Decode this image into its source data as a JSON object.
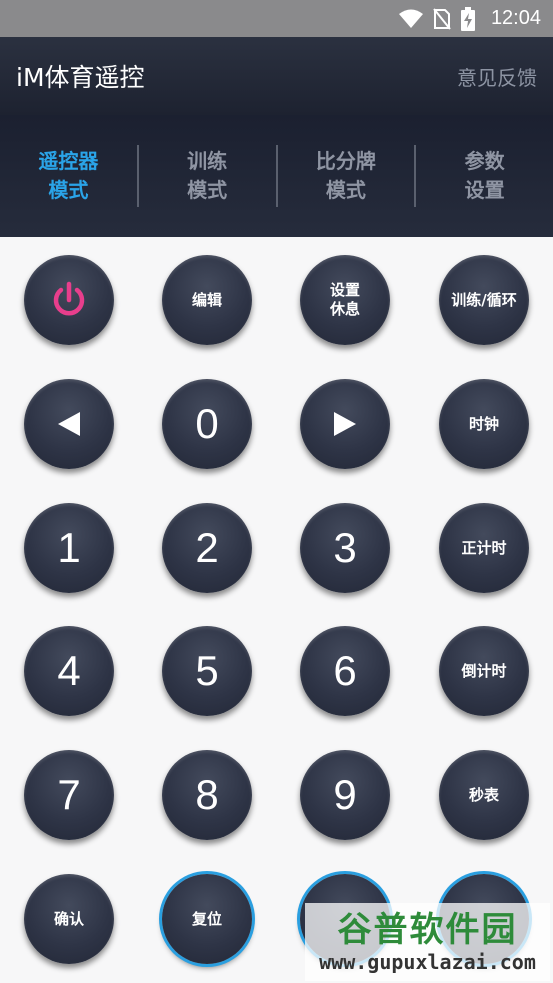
{
  "status_bar": {
    "time": "12:04"
  },
  "app_bar": {
    "title": "iM体育遥控",
    "feedback": "意见反馈"
  },
  "tabs": [
    {
      "line1": "遥控器",
      "line2": "模式",
      "active": true
    },
    {
      "line1": "训练",
      "line2": "模式",
      "active": false
    },
    {
      "line1": "比分牌",
      "line2": "模式",
      "active": false
    },
    {
      "line1": "参数",
      "line2": "设置",
      "active": false
    }
  ],
  "keypad": {
    "edit": "编辑",
    "set_rest_line1": "设置",
    "set_rest_line2": "休息",
    "train_loop": "训练/循环",
    "zero": "0",
    "clock": "时钟",
    "one": "1",
    "two": "2",
    "three": "3",
    "count_up": "正计时",
    "four": "4",
    "five": "5",
    "six": "6",
    "count_down": "倒计时",
    "seven": "7",
    "eight": "8",
    "nine": "9",
    "stopwatch": "秒表",
    "confirm": "确认",
    "reset": "复位"
  },
  "watermark": {
    "title": "谷普软件园",
    "url": "www.gupuxlazai.com"
  },
  "colors": {
    "accent": "#2aa4e8",
    "power": "#e83e8c",
    "header": "#1d2230"
  }
}
